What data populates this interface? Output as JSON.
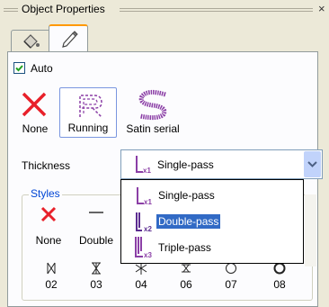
{
  "panel": {
    "title": "Object Properties",
    "close": "×"
  },
  "tabs": [
    {
      "name": "fill-tab",
      "icon": "paint-bucket-icon"
    },
    {
      "name": "outline-tab",
      "icon": "pencil-icon"
    }
  ],
  "auto": {
    "label": "Auto",
    "checked": true
  },
  "stitch_types": [
    {
      "label": "None",
      "icon": "red-x-icon"
    },
    {
      "label": "Running",
      "icon": "running-stitch-icon",
      "selected": true
    },
    {
      "label": "Satin serial",
      "icon": "satin-serial-icon"
    }
  ],
  "thickness": {
    "label": "Thickness",
    "value": "Single-pass"
  },
  "styles": {
    "label": "Styles",
    "row1": [
      {
        "label": "None"
      },
      {
        "label": "Double"
      }
    ],
    "row2": [
      "02",
      "03",
      "04",
      "06",
      "07",
      "08"
    ]
  },
  "dropdown": {
    "options": [
      {
        "label": "Single-pass",
        "badge": "x1"
      },
      {
        "label": "Double-pass",
        "badge": "x2",
        "highlighted": true
      },
      {
        "label": "Triple-pass",
        "badge": "x3"
      }
    ]
  },
  "colors": {
    "accent": "#316ac5",
    "icon": "#8b3fa6",
    "none_x": "#e8202a",
    "tab_highlight": "#ff9900"
  }
}
